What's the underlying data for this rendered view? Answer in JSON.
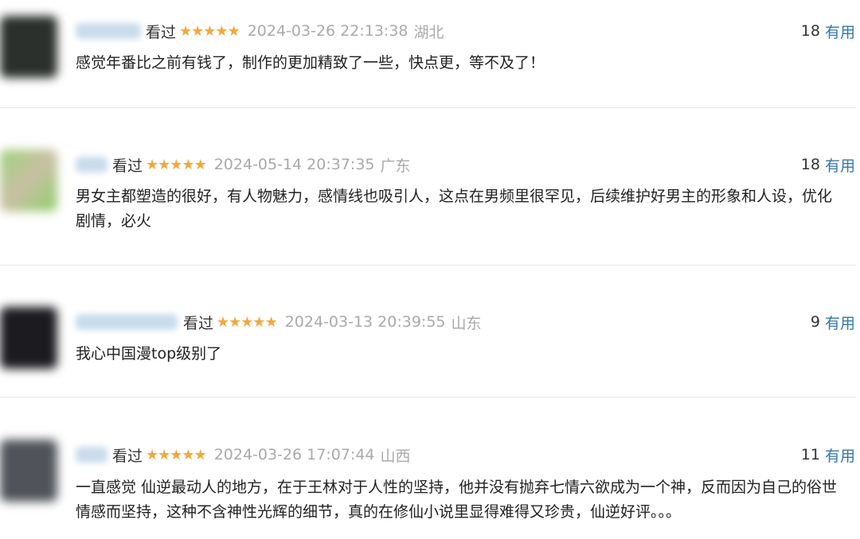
{
  "comments": [
    {
      "watched_label": "看过",
      "stars": "★★★★★",
      "time": "2024-03-26 22:13:38",
      "location": "湖北",
      "votes": "18",
      "useful_label": "有用",
      "text": "感觉年番比之前有钱了，制作的更加精致了一些，快点更，等不及了！"
    },
    {
      "watched_label": "看过",
      "stars": "★★★★★",
      "time": "2024-05-14 20:37:35",
      "location": "广东",
      "votes": "18",
      "useful_label": "有用",
      "text": "男女主都塑造的很好，有人物魅力，感情线也吸引人，这点在男频里很罕见，后续维护好男主的形象和人设，优化剧情，必火"
    },
    {
      "watched_label": "看过",
      "stars": "★★★★★",
      "time": "2024-03-13 20:39:55",
      "location": "山东",
      "votes": "9",
      "useful_label": "有用",
      "text": "我心中国漫top级别了"
    },
    {
      "watched_label": "看过",
      "stars": "★★★★★",
      "time": "2024-03-26 17:07:44",
      "location": "山西",
      "votes": "11",
      "useful_label": "有用",
      "text": "一直感觉 仙逆最动人的地方，在于王林对于人性的坚持，他并没有抛弃七情六欲成为一个神，反而因为自己的俗世情感而坚持，这种不含神性光辉的细节，真的在修仙小说里显得难得又珍贵，仙逆好评。。。"
    }
  ],
  "colors": {
    "star": "#f3a83b",
    "link": "#3377aa",
    "meta_gray": "#aaaaaa",
    "text": "#222222"
  }
}
